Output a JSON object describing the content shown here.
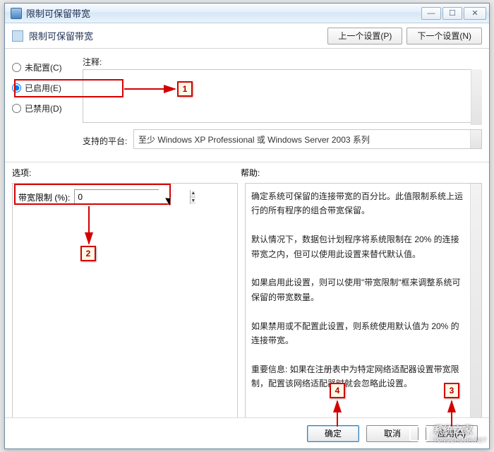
{
  "window": {
    "title": "限制可保留带宽"
  },
  "header": {
    "title": "限制可保留带宽",
    "prev_btn": "上一个设置(P)",
    "next_btn": "下一个设置(N)"
  },
  "radios": {
    "not_configured": "未配置(C)",
    "enabled": "已启用(E)",
    "disabled": "已禁用(D)",
    "selected": "enabled"
  },
  "comments": {
    "label": "注释:",
    "value": ""
  },
  "platform": {
    "label": "支持的平台:",
    "value": "至少 Windows XP Professional 或 Windows Server 2003 系列"
  },
  "sections": {
    "options_label": "选项:",
    "help_label": "帮助:"
  },
  "options": {
    "bandwidth_limit_label": "带宽限制 (%):",
    "bandwidth_limit_value": "0"
  },
  "help": {
    "p1": "确定系统可保留的连接带宽的百分比。此值限制系统上运行的所有程序的组合带宽保留。",
    "p2": "默认情况下，数据包计划程序将系统限制在 20% 的连接带宽之内，但可以使用此设置来替代默认值。",
    "p3": "如果启用此设置，则可以使用\"带宽限制\"框来调整系统可保留的带宽数量。",
    "p4": "如果禁用或不配置此设置，则系统使用默认值为 20% 的连接带宽。",
    "p5": "重要信息: 如果在注册表中为特定网络适配器设置带宽限制，配置该网络适配器时就会忽略此设置。"
  },
  "buttons": {
    "ok": "确定",
    "cancel": "取消",
    "apply": "应用(A)"
  },
  "annotations": {
    "c1": "1",
    "c2": "2",
    "c3": "3",
    "c4": "4"
  },
  "watermark": {
    "text": "系统之家",
    "sub": "TONGZHUJIA.NET"
  }
}
